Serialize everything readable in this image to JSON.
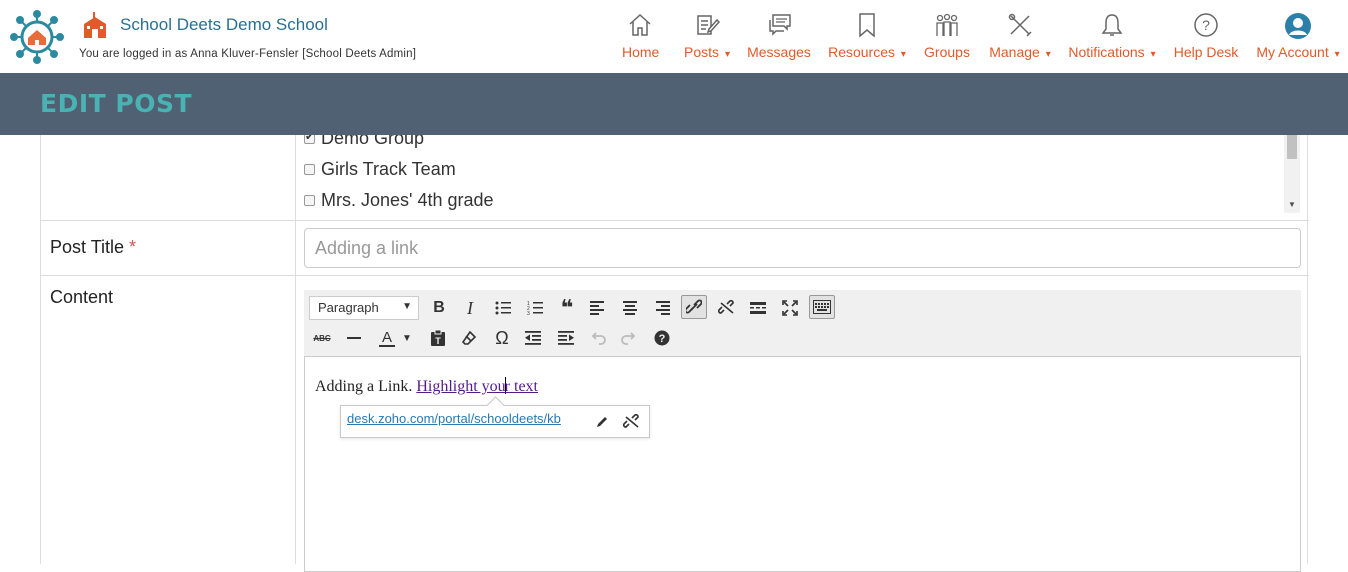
{
  "header": {
    "school_name": "School Deets Demo School",
    "logged_in_text": "You are logged in as Anna Kluver-Fensler [School Deets Admin]"
  },
  "nav": {
    "home": "Home",
    "posts": "Posts",
    "messages": "Messages",
    "resources": "Resources",
    "groups": "Groups",
    "manage": "Manage",
    "notifications": "Notifications",
    "help_desk": "Help Desk",
    "my_account": "My Account",
    "caret": "▾"
  },
  "page": {
    "title": "EDIT POST"
  },
  "groups": {
    "items": [
      {
        "label": "Demo Group",
        "checked": true
      },
      {
        "label": "Girls Track Team",
        "checked": false
      },
      {
        "label": "Mrs. Jones' 4th grade",
        "checked": false
      }
    ]
  },
  "form": {
    "post_title_label": "Post Title",
    "required_mark": "*",
    "post_title_value": "Adding  a link",
    "content_label": "Content"
  },
  "editor": {
    "format_value": "Paragraph",
    "content_plain": "Adding a Link. ",
    "link_text_before_cursor": "Highlight you",
    "link_text_after_cursor": "r text",
    "link_url": "desk.zoho.com/portal/schooldeets/kb"
  },
  "colors": {
    "accent": "#e05a2b",
    "title_bar": "#4f6172",
    "title_text": "#49b3b3",
    "school_name": "#2a6f8f"
  }
}
